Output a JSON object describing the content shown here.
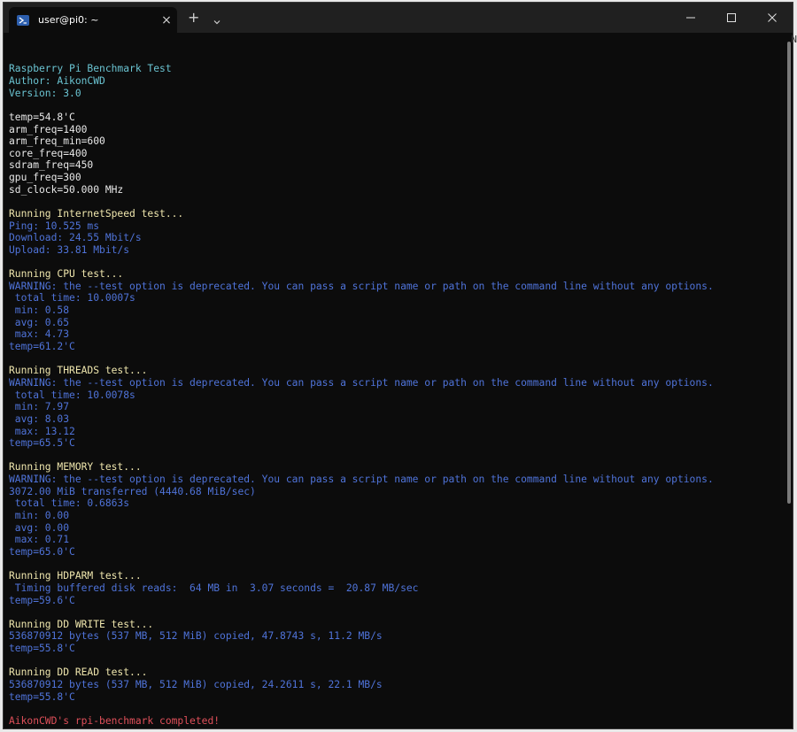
{
  "window": {
    "tab_title": "user@pi0: ~",
    "tab_close": "×",
    "new_tab": "+"
  },
  "terminal": {
    "lines": [
      {
        "text": "Raspberry Pi Benchmark Test",
        "color": "cyan"
      },
      {
        "text": "Author: AikonCWD",
        "color": "cyan"
      },
      {
        "text": "Version: 3.0",
        "color": "cyan"
      },
      {
        "text": "",
        "color": "white"
      },
      {
        "text": "temp=54.8'C",
        "color": "white"
      },
      {
        "text": "arm_freq=1400",
        "color": "white"
      },
      {
        "text": "arm_freq_min=600",
        "color": "white"
      },
      {
        "text": "core_freq=400",
        "color": "white"
      },
      {
        "text": "sdram_freq=450",
        "color": "white"
      },
      {
        "text": "gpu_freq=300",
        "color": "white"
      },
      {
        "text": "sd_clock=50.000 MHz",
        "color": "white"
      },
      {
        "text": "",
        "color": "white"
      },
      {
        "text": "Running InternetSpeed test...",
        "color": "yellow"
      },
      {
        "text": "Ping: 10.525 ms",
        "color": "blue"
      },
      {
        "text": "Download: 24.55 Mbit/s",
        "color": "blue"
      },
      {
        "text": "Upload: 33.81 Mbit/s",
        "color": "blue"
      },
      {
        "text": "",
        "color": "white"
      },
      {
        "text": "Running CPU test...",
        "color": "yellow"
      },
      {
        "text": "WARNING: the --test option is deprecated. You can pass a script name or path on the command line without any options.",
        "color": "blue"
      },
      {
        "text": " total time: 10.0007s",
        "color": "blue"
      },
      {
        "text": " min: 0.58",
        "color": "blue"
      },
      {
        "text": " avg: 0.65",
        "color": "blue"
      },
      {
        "text": " max: 4.73",
        "color": "blue"
      },
      {
        "text": "temp=61.2'C",
        "color": "blue"
      },
      {
        "text": "",
        "color": "white"
      },
      {
        "text": "Running THREADS test...",
        "color": "yellow"
      },
      {
        "text": "WARNING: the --test option is deprecated. You can pass a script name or path on the command line without any options.",
        "color": "blue"
      },
      {
        "text": " total time: 10.0078s",
        "color": "blue"
      },
      {
        "text": " min: 7.97",
        "color": "blue"
      },
      {
        "text": " avg: 8.03",
        "color": "blue"
      },
      {
        "text": " max: 13.12",
        "color": "blue"
      },
      {
        "text": "temp=65.5'C",
        "color": "blue"
      },
      {
        "text": "",
        "color": "white"
      },
      {
        "text": "Running MEMORY test...",
        "color": "yellow"
      },
      {
        "text": "WARNING: the --test option is deprecated. You can pass a script name or path on the command line without any options.",
        "color": "blue"
      },
      {
        "text": "3072.00 MiB transferred (4440.68 MiB/sec)",
        "color": "blue"
      },
      {
        "text": " total time: 0.6863s",
        "color": "blue"
      },
      {
        "text": " min: 0.00",
        "color": "blue"
      },
      {
        "text": " avg: 0.00",
        "color": "blue"
      },
      {
        "text": " max: 0.71",
        "color": "blue"
      },
      {
        "text": "temp=65.0'C",
        "color": "blue"
      },
      {
        "text": "",
        "color": "white"
      },
      {
        "text": "Running HDPARM test...",
        "color": "yellow"
      },
      {
        "text": " Timing buffered disk reads:  64 MB in  3.07 seconds =  20.87 MB/sec",
        "color": "blue"
      },
      {
        "text": "temp=59.6'C",
        "color": "blue"
      },
      {
        "text": "",
        "color": "white"
      },
      {
        "text": "Running DD WRITE test...",
        "color": "yellow"
      },
      {
        "text": "536870912 bytes (537 MB, 512 MiB) copied, 47.8743 s, 11.2 MB/s",
        "color": "blue"
      },
      {
        "text": "temp=55.8'C",
        "color": "blue"
      },
      {
        "text": "",
        "color": "white"
      },
      {
        "text": "Running DD READ test...",
        "color": "yellow"
      },
      {
        "text": "536870912 bytes (537 MB, 512 MiB) copied, 24.2611 s, 22.1 MB/s",
        "color": "blue"
      },
      {
        "text": "temp=55.8'C",
        "color": "blue"
      },
      {
        "text": "",
        "color": "white"
      },
      {
        "text": "AikonCWD's rpi-benchmark completed!",
        "color": "red"
      }
    ],
    "prompt": {
      "user_host": "user@pi0",
      "path": ":~ $"
    }
  },
  "colors": {
    "cyan": "#6ac3d1",
    "white": "#e8e8e8",
    "yellow": "#efe6ad",
    "blue": "#4f73d9",
    "red": "#e0505a",
    "green": "#5fd35f",
    "background": "#0c0c0c",
    "titlebar": "#202020"
  },
  "edge_char": "N"
}
